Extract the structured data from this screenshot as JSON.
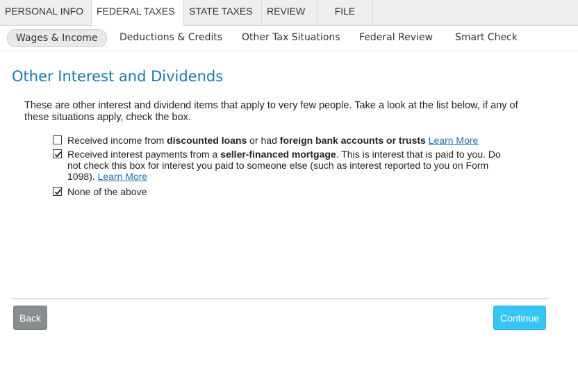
{
  "top_tabs": [
    {
      "label": "PERSONAL INFO",
      "active": false
    },
    {
      "label": "FEDERAL TAXES",
      "active": true
    },
    {
      "label": "STATE TAXES",
      "active": false
    },
    {
      "label": "REVIEW",
      "active": false
    },
    {
      "label": "FILE",
      "active": false
    }
  ],
  "sub_nav": [
    {
      "label": "Wages & Income",
      "active": true
    },
    {
      "label": "Deductions & Credits",
      "active": false
    },
    {
      "label": "Other Tax Situations",
      "active": false
    },
    {
      "label": "Federal Review",
      "active": false
    },
    {
      "label": "Smart Check",
      "active": false
    }
  ],
  "page": {
    "title": "Other Interest and Dividends",
    "intro": "These are other interest and dividend items that apply to very few people. Take a look at the list below, if any of these situations apply, check the box."
  },
  "options": [
    {
      "checked": false,
      "text_1": "Received income from ",
      "bold_1": "discounted loans",
      "text_2": " or had ",
      "bold_2": "foreign bank accounts or trusts",
      "text_3": " ",
      "link": "Learn More"
    },
    {
      "checked": true,
      "text_1": "Received interest payments from a ",
      "bold_1": "seller-financed mortgage",
      "text_2": ". This is interest that is paid to you. Do not check this box for interest you paid to someone else (such as interest reported to you on Form 1098). ",
      "link": "Learn More"
    },
    {
      "checked": true,
      "text_1": "None of the above"
    }
  ],
  "buttons": {
    "back": "Back",
    "continue": "Continue"
  },
  "colors": {
    "title": "#1779a9",
    "link": "#1a6fa8",
    "continue_button": "#36c5f5",
    "back_button": "#8a8d8f"
  }
}
